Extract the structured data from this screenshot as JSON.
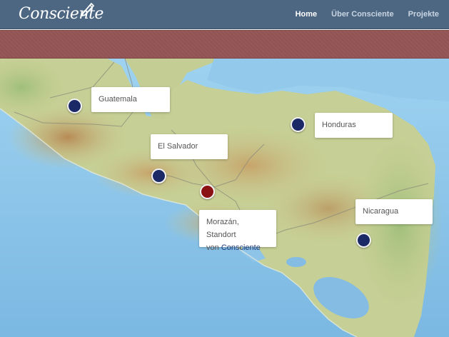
{
  "navbar": {
    "logo_text": "Consciente",
    "links": [
      {
        "label": "Home",
        "active": true
      },
      {
        "label": "Über Consciente",
        "active": false
      },
      {
        "label": "Projekte",
        "active": false
      }
    ]
  },
  "map": {
    "markers": [
      {
        "label": "Guatemala",
        "color": "#1b2a66"
      },
      {
        "label": "El Salvador",
        "color": "#1b2a66"
      },
      {
        "label": "Honduras",
        "color": "#1b2a66"
      },
      {
        "label": "Nicaragua",
        "color": "#1b2a66"
      },
      {
        "label_line1": "Morazán, Standort",
        "label_prefix": "von",
        "label_brand": "Consciente",
        "color": "#8b1212"
      }
    ]
  },
  "colors": {
    "navbar_bg": "#4d6782",
    "banner_bg": "#985858",
    "marker_blue": "#1b2a66",
    "marker_red": "#8b1212",
    "ocean": "#8ec4e8",
    "land": "#c6cf95"
  }
}
